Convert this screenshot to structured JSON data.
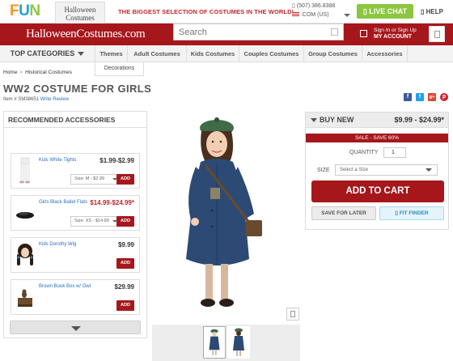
{
  "topbar": {
    "fun_logo": [
      "F",
      "U",
      "N"
    ],
    "hc_tab": [
      "Halloween",
      "Costumes"
    ],
    "promo": "THE BIGGEST SELECTION OF COSTUMES IN THE WORLD!",
    "phone": "(507) 386.8388",
    "locale": ".COM (US)",
    "live_chat": "LIVE CHAT",
    "help": "HELP"
  },
  "header": {
    "logo": "HalloweenCostumes.com",
    "search_placeholder": "Search",
    "account_line1": "Sign In or Sign Up",
    "account_line2": "MY ACCOUNT"
  },
  "nav": {
    "top_categories": "TOP CATEGORIES",
    "items": [
      "Themes",
      "Adult Costumes",
      "Kids Costumes",
      "Couples Costumes",
      "Group Costumes",
      "Accessories"
    ],
    "dropdown_item": "Decorations"
  },
  "breadcrumb": [
    "Home",
    "Historical Costumes"
  ],
  "product": {
    "title": "WW2 COSTUME FOR GIRLS",
    "item_no": "Item # SM38651",
    "write_review": "Write Review"
  },
  "social": [
    {
      "icon": "facebook-icon",
      "glyph": "f",
      "color": "#3b5998"
    },
    {
      "icon": "twitter-icon",
      "glyph": "t",
      "color": "#1da1f2"
    },
    {
      "icon": "google-plus-icon",
      "glyph": "g+",
      "color": "#dd4b39"
    },
    {
      "icon": "pinterest-icon",
      "glyph": "p",
      "color": "#cb2027"
    }
  ],
  "accessories": {
    "heading": "RECOMMENDED ACCESSORIES",
    "items": [
      {
        "name": "Kids White Tights",
        "price": "$1.99-$2.99",
        "size": "Size: M - $2.99",
        "add": "ADD"
      },
      {
        "name": "Girls Black Ballet Flats",
        "price": "$14.99-$24.99*",
        "size": "Size: XS - $14.99",
        "add": "ADD"
      },
      {
        "name": "Kids Dorothy Wig",
        "price": "$9.99",
        "add": "ADD"
      },
      {
        "name": "Brown Book Box w/ Owl",
        "price": "$29.99",
        "add": "ADD"
      }
    ]
  },
  "buy": {
    "label": "BUY NEW",
    "price": "$9.99 - $24.99*",
    "sale": "SALE - SAVE 60%",
    "qty_label": "QUANTITY",
    "qty_value": "1",
    "size_label": "SIZE",
    "size_placeholder": "Select a Size",
    "add_to_cart": "ADD TO CART",
    "save_later": "SAVE FOR LATER",
    "fit_finder": "FIT FINDER"
  },
  "colors": {
    "brand_red": "#a6171c",
    "accent_green": "#8cc63f",
    "link_blue": "#2a6ebb"
  }
}
